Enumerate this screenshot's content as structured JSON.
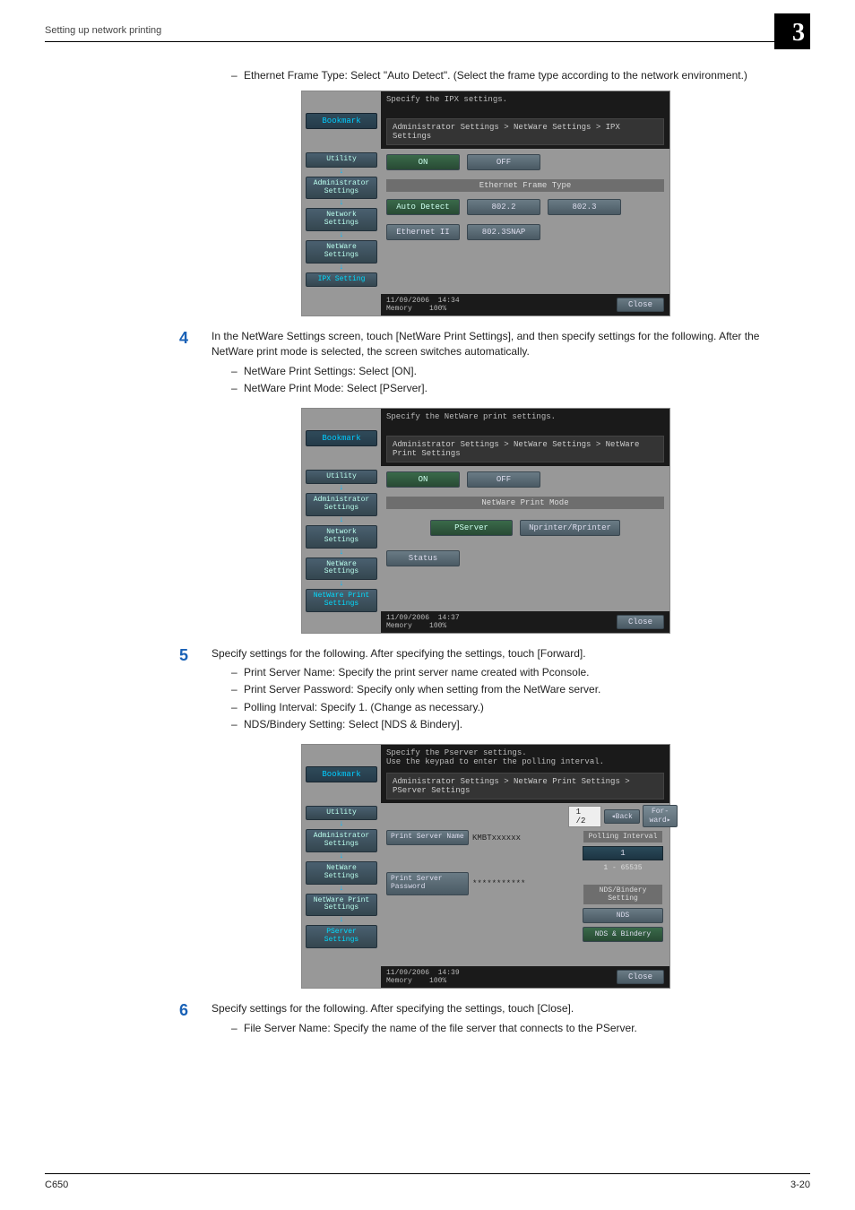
{
  "page": {
    "running_head": "Setting up network printing",
    "chapter_num": "3",
    "footer_left": "C650",
    "footer_right": "3-20"
  },
  "intro_bullet": "Ethernet Frame Type: Select \"Auto Detect\". (Select the frame type according to the network environment.)",
  "screenshot1": {
    "instr": "Specify the IPX settings.",
    "breadcrumb": "Administrator Settings > NetWare Settings > IPX Settings",
    "left": {
      "bookmark": "Bookmark",
      "utility": "Utility",
      "admin": "Administrator Settings",
      "network": "Network Settings",
      "netware": "NetWare Settings",
      "ipx": "IPX Setting"
    },
    "on": "ON",
    "off": "OFF",
    "section": "Ethernet Frame Type",
    "opts": {
      "auto": "Auto Detect",
      "b8022": "802.2",
      "b8023": "802.3",
      "eth2": "Ethernet II",
      "snap": "802.3SNAP"
    },
    "footer": {
      "date": "11/09/2006",
      "time": "14:34",
      "mem": "Memory",
      "pct": "100%",
      "close": "Close"
    }
  },
  "step4": {
    "num": "4",
    "text": "In the NetWare Settings screen, touch [NetWare Print Settings], and then specify settings for the following. After the NetWare print mode is selected, the screen switches automatically.",
    "b1": "NetWare Print Settings: Select [ON].",
    "b2": "NetWare Print Mode: Select [PServer]."
  },
  "screenshot2": {
    "instr": "Specify the NetWare print settings.",
    "breadcrumb": "Administrator Settings > NetWare Settings > NetWare Print Settings",
    "left": {
      "bookmark": "Bookmark",
      "utility": "Utility",
      "admin": "Administrator Settings",
      "network": "Network Settings",
      "netware": "NetWare Settings",
      "print": "NetWare Print Settings"
    },
    "on": "ON",
    "off": "OFF",
    "section": "NetWare Print Mode",
    "pserver": "PServer",
    "nprinter": "Nprinter/Rprinter",
    "status": "Status",
    "footer": {
      "date": "11/09/2006",
      "time": "14:37",
      "mem": "Memory",
      "pct": "100%",
      "close": "Close"
    }
  },
  "step5": {
    "num": "5",
    "text": "Specify settings for the following. After specifying the settings, touch [Forward].",
    "b1": "Print Server Name: Specify the print server name created with Pconsole.",
    "b2": "Print Server Password: Specify only when setting from the NetWare server.",
    "b3": "Polling Interval: Specify 1. (Change as necessary.)",
    "b4": "NDS/Bindery Setting: Select [NDS & Bindery]."
  },
  "screenshot3": {
    "instr1": "Specify the Pserver settings.",
    "instr2": "Use the keypad to enter the polling interval.",
    "breadcrumb": "Administrator Settings > NetWare Print Settings > PServer Settings",
    "left": {
      "bookmark": "Bookmark",
      "utility": "Utility",
      "admin": "Administrator Settings",
      "netware": "NetWare Settings",
      "print": "NetWare Print Settings",
      "pserver": "PServer Settings"
    },
    "psn_label": "Print Server Name",
    "psn_value": "KMBTxxxxxx",
    "psp_label": "Print Server Password",
    "psp_value": "***********",
    "page_count": "1 /2",
    "back": "Back",
    "forward": "For- ward",
    "poll_header": "Polling Interval",
    "poll_val": "1",
    "poll_range": "1   -   65535",
    "nds_header": "NDS/Bindery Setting",
    "nds": "NDS",
    "nds_bind": "NDS & Bindery",
    "footer": {
      "date": "11/09/2006",
      "time": "14:39",
      "mem": "Memory",
      "pct": "100%",
      "close": "Close"
    }
  },
  "step6": {
    "num": "6",
    "text": "Specify settings for the following. After specifying the settings, touch [Close].",
    "b1": "File Server Name: Specify the name of the file server that connects to the PServer."
  }
}
